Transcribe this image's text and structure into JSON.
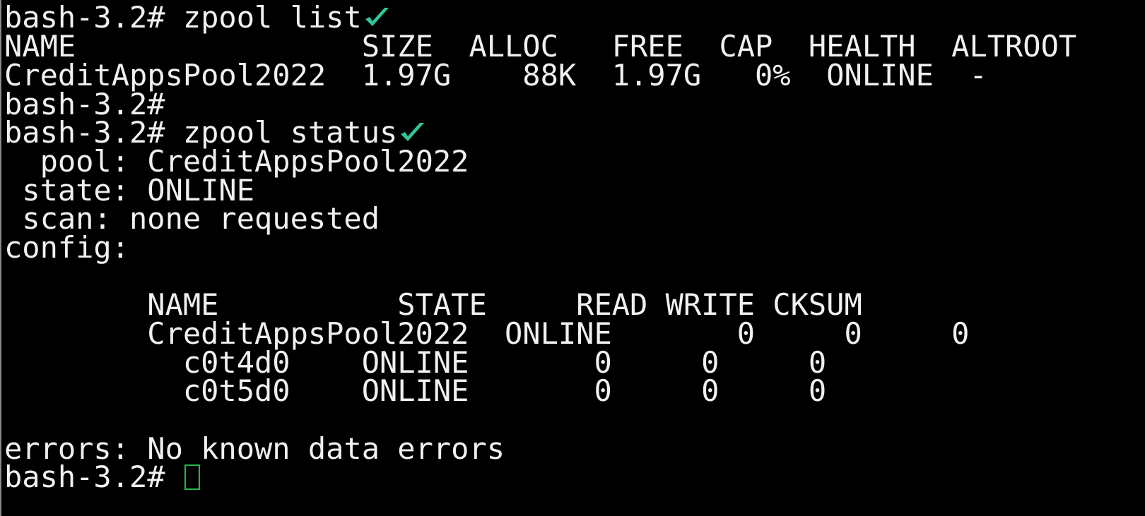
{
  "terminal": {
    "lines": [
      {
        "text": "bash-3.2# zpool list",
        "check": true
      },
      {
        "text": "NAME                SIZE  ALLOC   FREE  CAP  HEALTH  ALTROOT"
      },
      {
        "text": "CreditAppsPool2022  1.97G    88K  1.97G   0%  ONLINE  -"
      },
      {
        "text": "bash-3.2#"
      },
      {
        "text": "bash-3.2# zpool status",
        "check": true
      },
      {
        "text": "  pool: CreditAppsPool2022"
      },
      {
        "text": " state: ONLINE"
      },
      {
        "text": " scan: none requested"
      },
      {
        "text": "config:"
      },
      {
        "text": ""
      },
      {
        "text": "        NAME          STATE     READ WRITE CKSUM"
      },
      {
        "text": "        CreditAppsPool2022  ONLINE       0     0     0"
      },
      {
        "text": "          c0t4d0    ONLINE       0     0     0"
      },
      {
        "text": "          c0t5d0    ONLINE       0     0     0"
      },
      {
        "text": ""
      },
      {
        "text": "errors: No known data errors"
      },
      {
        "text": "bash-3.2# ",
        "cursor": true
      }
    ]
  },
  "colors": {
    "background": "#000000",
    "text": "#f0f0f0",
    "check_mark": "#2fc79a",
    "cursor": "#1fb84a"
  },
  "icons": {
    "command_marker": "check-icon",
    "cursor": "block-cursor"
  }
}
